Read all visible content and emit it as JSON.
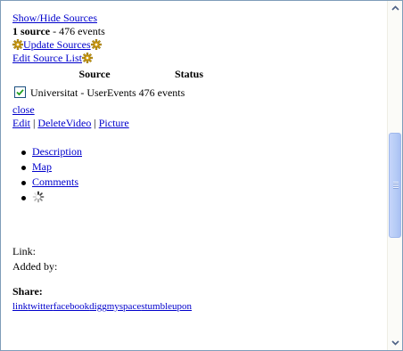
{
  "links": {
    "show_hide_sources": "Show/Hide Sources",
    "update_sources": "Update Sources",
    "edit_source_list": "Edit Source List",
    "close": "close",
    "edit": "Edit",
    "sep1": " | ",
    "delete_video": "DeleteVideo",
    "sep2": " | ",
    "picture": "Picture"
  },
  "summary": {
    "count_bold": "1 source",
    "rest": " - 476 events"
  },
  "sources_table": {
    "headers": [
      "Source",
      "Status"
    ],
    "rows": [
      {
        "checked": true,
        "text": "Universitat - UserEvents 476 events"
      }
    ]
  },
  "tabs": [
    "Description",
    "Map",
    "Comments"
  ],
  "details": {
    "link_label": "Link:",
    "added_by_label": "Added by:",
    "share_label": "Share:",
    "share_links": [
      "link",
      "twitter",
      "facebook",
      "digg",
      "myspace",
      "stumbleupon"
    ]
  },
  "icons": {
    "update_left": "gear-icon",
    "update_right": "gear-icon",
    "edit_list": "gear-icon",
    "loading": "loading-spinner-icon"
  },
  "colors": {
    "link": "#0000cc",
    "gear": "#c8a000",
    "scroll_thumb": "#b8cdf6"
  }
}
